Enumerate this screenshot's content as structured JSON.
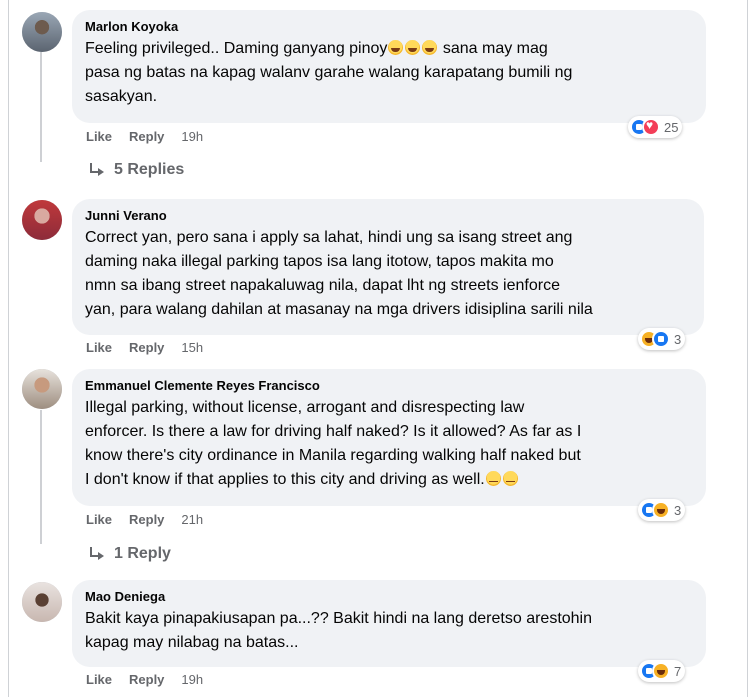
{
  "comments": [
    {
      "author": "Marlon Koyoka",
      "lines": [
        "Feeling privileged.. Daming ganyang pinoy",
        "pasa ng batas na kapag walanv garahe walang karapatang bumili ng",
        "sasakyan."
      ],
      "line1_suffix": " sana may mag",
      "like_label": "Like",
      "reply_label": "Reply",
      "time": "19h",
      "reaction_icons": [
        "like-icon",
        "love-icon"
      ],
      "reaction_count": "25",
      "replies_label": "5 Replies"
    },
    {
      "author": "Junni Verano",
      "lines": [
        "Correct yan, pero sana i apply sa lahat, hindi ung sa isang street ang",
        "daming naka illegal parking tapos isa lang itotow, tapos makita mo",
        "nmn sa ibang street napakaluwag nila, dapat lht ng streets ienforce",
        "yan, para walang dahilan at masanay na mga drivers idisiplina sarili nila"
      ],
      "like_label": "Like",
      "reply_label": "Reply",
      "time": "15h",
      "reaction_icons": [
        "haha-icon",
        "like-icon"
      ],
      "reaction_count": "3"
    },
    {
      "author": "Emmanuel Clemente Reyes Francisco",
      "lines": [
        "Illegal parking, without license, arrogant and disrespecting law",
        "enforcer. Is there a law for driving half naked? Is it allowed? As far as I",
        "know there's city ordinance in Manila regarding walking half naked but",
        "I don't know if that applies to this city and driving as well."
      ],
      "like_label": "Like",
      "reply_label": "Reply",
      "time": "21h",
      "reaction_icons": [
        "like-icon",
        "haha-icon"
      ],
      "reaction_count": "3",
      "replies_label": "1 Reply"
    },
    {
      "author": "Mao Deniega",
      "lines": [
        "Bakit kaya pinapakiusapan pa...?? Bakit hindi na lang deretso arestohin",
        "kapag may nilabag na batas..."
      ],
      "like_label": "Like",
      "reply_label": "Reply",
      "time": "19h",
      "reaction_icons": [
        "like-icon",
        "haha-icon"
      ],
      "reaction_count": "7"
    }
  ],
  "colors": {
    "bubble": "#f0f2f5",
    "meta_text": "#65676b",
    "like_blue": "#1877f2",
    "love_red": "#f33e58",
    "haha_yellow": "#f7b125"
  }
}
